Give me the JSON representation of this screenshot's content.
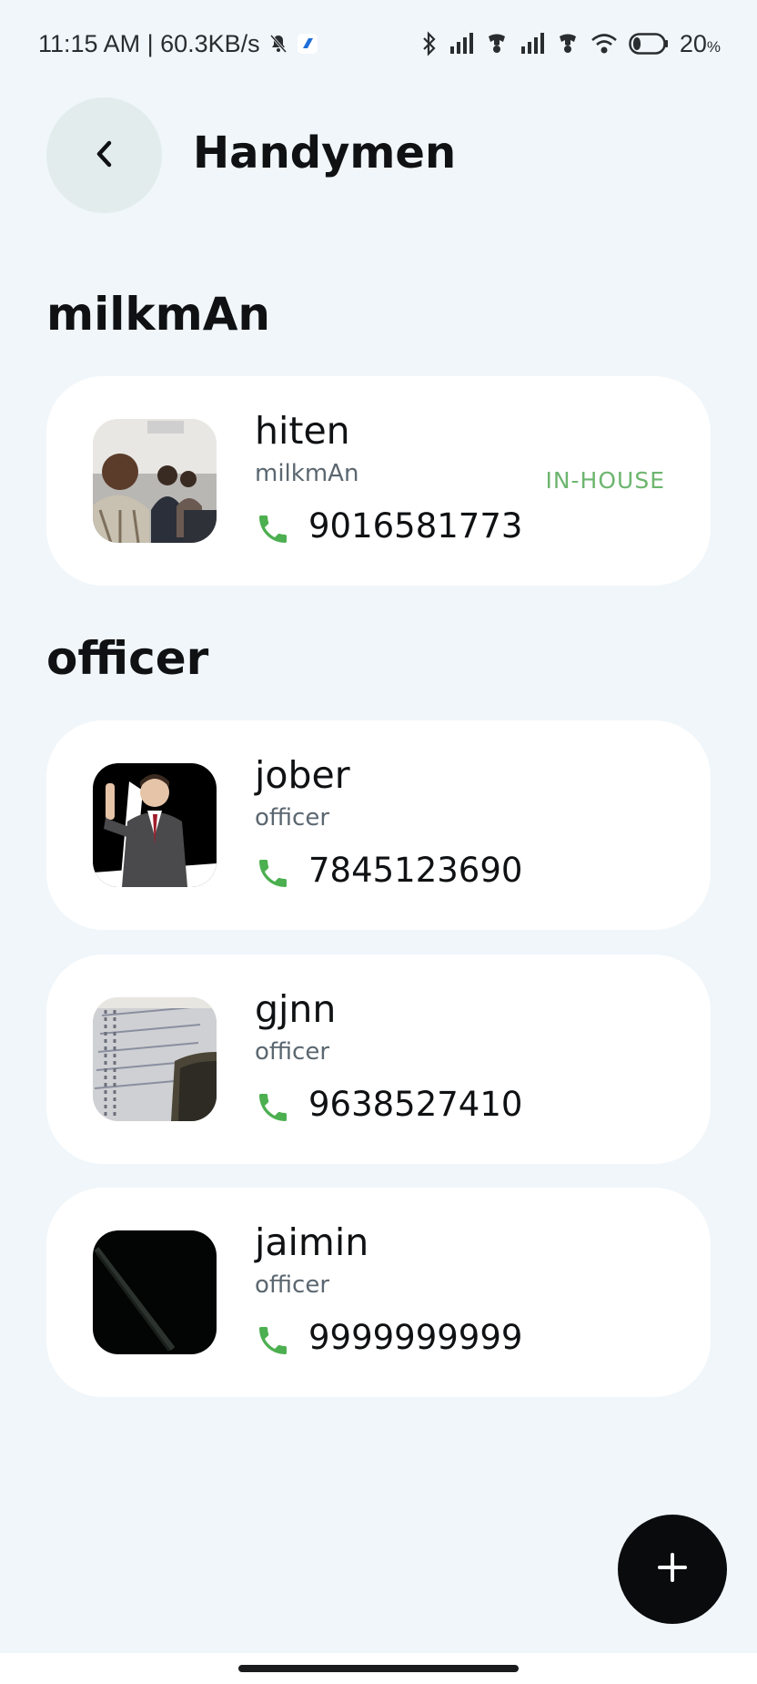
{
  "status_bar": {
    "time_speed": "11:15 AM | 60.3KB/s",
    "battery": "20",
    "battery_unit": "%"
  },
  "header": {
    "title": "Handymen",
    "back_icon": "chevron-left-icon"
  },
  "sections": [
    {
      "title": "milkmAn",
      "contacts": [
        {
          "name": "hiten",
          "role": "milkmAn",
          "phone": "9016581773",
          "badge": "IN-HOUSE",
          "avatar": "group-photo"
        }
      ]
    },
    {
      "title": "officer",
      "contacts": [
        {
          "name": "jober",
          "role": "officer",
          "phone": "7845123690",
          "avatar": "businessman-3d-figure"
        },
        {
          "name": "gjnn",
          "role": "officer",
          "phone": "9638527410",
          "avatar": "notebook-and-phone"
        },
        {
          "name": "jaimin",
          "role": "officer",
          "phone": "9999999999",
          "avatar": "dark-photo"
        }
      ]
    }
  ],
  "fab": {
    "icon": "plus-icon"
  },
  "colors": {
    "background": "#f0f6fa",
    "card": "#ffffff",
    "accent_green": "#6db56f",
    "phone_icon_green": "#4caf50",
    "fab": "#0a0b0c"
  }
}
